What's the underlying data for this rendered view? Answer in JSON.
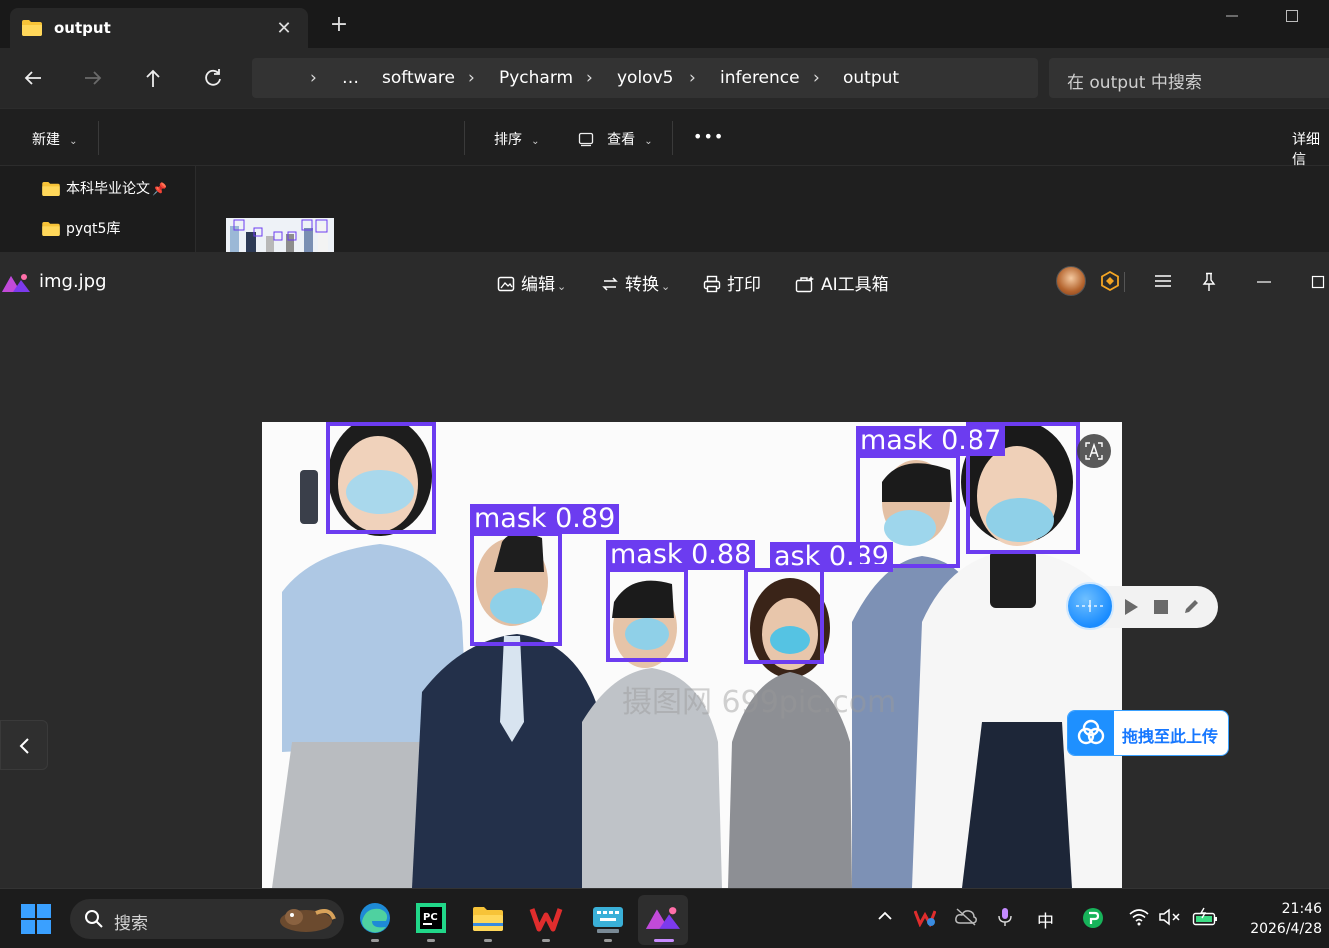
{
  "explorer": {
    "tab_title": "output",
    "new_tab": "+",
    "close": "✕",
    "breadcrumb": [
      "…",
      "software",
      "Pycharm",
      "yolov5",
      "inference",
      "output"
    ],
    "search_placeholder": "在 output 中搜索",
    "commands": {
      "new": "新建",
      "sort": "排序",
      "view": "查看",
      "more": "•••",
      "details": "详细信"
    },
    "sidebar": [
      {
        "label": "本科毕业论文",
        "pinned": true
      },
      {
        "label": "pyqt5库",
        "pinned": false
      }
    ]
  },
  "viewer": {
    "title": "img.jpg",
    "tools": {
      "edit": "编辑",
      "convert": "转换",
      "print": "打印",
      "ai": "AI工具箱"
    },
    "detections": [
      "mask 0.89",
      "mask 0.88",
      "ask 0.89",
      "mask 0.87"
    ],
    "upload_label": "拖拽至此上传",
    "watermark": "摄图网 699pic.com"
  },
  "taskbar": {
    "search": "搜索",
    "ime": "中",
    "time": "21:46",
    "date": "2026/4/28"
  },
  "colors": {
    "detection_box": "#6c3cf0",
    "accent_blue": "#1e90ff"
  }
}
